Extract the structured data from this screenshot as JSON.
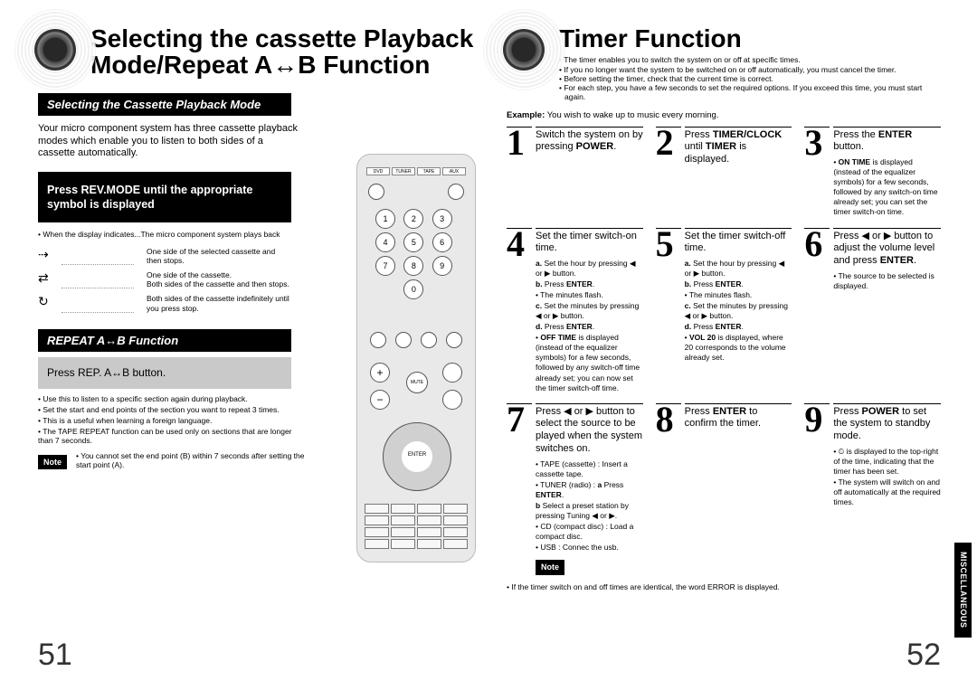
{
  "left": {
    "title": "Selecting the cassette Playback Mode/Repeat A↔B Function",
    "sec1_head": "Selecting the Cassette Playback Mode",
    "sec1_body": "Your micro component system has three cassette playback modes which enable you to listen to both sides of a cassette automatically.",
    "sec1_bar": "Press REV.MODE until the appropriate symbol is displayed",
    "sec1_mini_lead": "• When the display indicates...The micro component system plays back",
    "sec1_mini_a": "One side of the selected cassette and then stops.",
    "sec1_mini_b": "One side of the cassette.\nBoth sides of the cassette and then stops.",
    "sec1_mini_c": "Both sides of the cassette indefinitely until you press stop.",
    "sec2_head": "REPEAT A↔B Function",
    "sec2_grey": "Press REP. A↔B button.",
    "tips": [
      "Use this to listen to a specific section again during playback.",
      "Set the start and end points of the section you want to repeat 3 times.",
      "This is a useful when learning a foreign language.",
      "The TAPE REPEAT function can be used only on sections that are longer than 7 seconds."
    ],
    "note_label": "Note",
    "note": "You cannot set the end point (B) within 7 seconds after setting the start point (A).",
    "page_num": "51"
  },
  "right": {
    "title": "Timer Function",
    "intro": [
      "The timer enables you to switch the system on or off at specific times.",
      "If you no longer want the system to be switched on or off automatically, you must cancel the timer.",
      "Before setting the timer, check that the current time is correct.",
      "For each step, you have a few seconds to set the required options. If you exceed this time, you must start again."
    ],
    "example_label": "Example:",
    "example_txt": "You wish to wake up to music every morning.",
    "steps": {
      "1": {
        "txt": "Switch the system on by pressing <b>POWER</b>."
      },
      "2": {
        "txt": "Press <b>TIMER/CLOCK</b> until <b>TIMER</b> is displayed."
      },
      "3": {
        "txt": "Press the <b>ENTER</b> button.",
        "sub": [
          "• <b>ON TIME</b> is displayed (instead of the equalizer symbols) for a few seconds, followed by any switch-on time already set; you can set the timer switch-on time."
        ]
      },
      "4": {
        "txt": "Set the timer switch-on time.",
        "sub": [
          "<b>a.</b> Set the hour by pressing ◀ or ▶ button.",
          "<b>b.</b> Press <b>ENTER</b>.",
          "• The minutes flash.",
          "<b>c.</b> Set the minutes by pressing ◀ or ▶ button.",
          "<b>d.</b> Press <b>ENTER</b>.",
          "• <b>OFF TIME</b> is displayed (instead of the equalizer symbols) for a few seconds, followed by any switch-off time already set; you can now set the timer switch-off time."
        ]
      },
      "5": {
        "txt": "Set the timer switch-off time.",
        "sub": [
          "<b>a.</b> Set the hour by pressing ◀ or ▶ button.",
          "<b>b.</b> Press <b>ENTER</b>.",
          "• The minutes flash.",
          "<b>c.</b> Set the minutes by pressing ◀ or ▶ button.",
          "<b>d.</b> Press <b>ENTER</b>.",
          "• <b>VOL 20</b> is displayed, where 20 corresponds to the volume already set."
        ]
      },
      "6": {
        "txt": "Press ◀ or ▶ button to adjust the volume level and press <b>ENTER</b>.",
        "sub": [
          "• The source to be selected is displayed."
        ]
      },
      "7": {
        "txt": "Press ◀ or ▶ button to select the source to be played when the system switches on.",
        "sub": [
          "• TAPE (cassette) : Insert a cassette tape.",
          "• TUNER (radio) : <b>a</b> Press <b>ENTER</b>.",
          "<b>b</b> Select a preset station by pressing Tuning ◀ or ▶.",
          "• CD (compact disc) : Load a compact disc.",
          "• USB    : Connec   the usb."
        ]
      },
      "8": {
        "txt": "Press <b>ENTER</b> to confirm the timer."
      },
      "9": {
        "txt": "Press <b>POWER</b> to set the system to standby mode.",
        "sub": [
          "• ⏲ is displayed to the top-right of the time, indicating that the timer has been set.",
          "• The system will switch on and off automatically at the required times."
        ]
      }
    },
    "bottom_note_label": "Note",
    "bottom_note": "If the timer switch on and off times are identical, the word ERROR is displayed.",
    "page_num": "52",
    "tab": "MISCELLANEOUS"
  }
}
